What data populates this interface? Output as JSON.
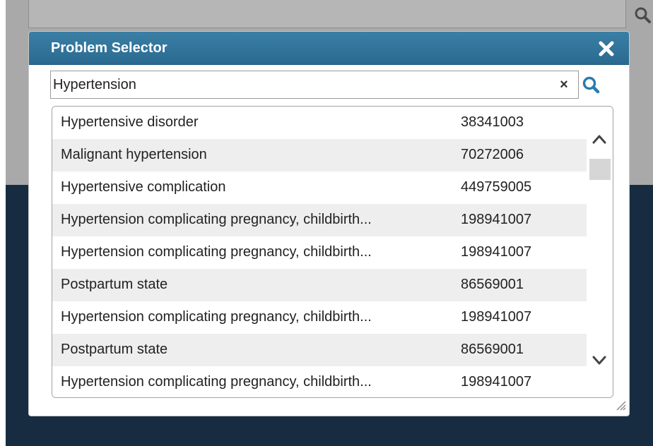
{
  "dialog": {
    "title": "Problem Selector",
    "close_icon": "close-icon"
  },
  "search": {
    "value": "Hypertension",
    "placeholder": "",
    "clear_label": "×",
    "search_icon": "search-icon"
  },
  "results": [
    {
      "name": "Hypertensive disorder",
      "code": "38341003"
    },
    {
      "name": "Malignant hypertension",
      "code": "70272006"
    },
    {
      "name": "Hypertensive complication",
      "code": "449759005"
    },
    {
      "name": "Hypertension complicating pregnancy, childbirth...",
      "code": "198941007"
    },
    {
      "name": "Hypertension complicating pregnancy, childbirth...",
      "code": "198941007"
    },
    {
      "name": "Postpartum state",
      "code": "86569001"
    },
    {
      "name": "Hypertension complicating pregnancy, childbirth...",
      "code": "198941007"
    },
    {
      "name": "Postpartum state",
      "code": "86569001"
    },
    {
      "name": "Hypertension complicating pregnancy, childbirth...",
      "code": "198941007"
    }
  ],
  "colors": {
    "titlebar": "#2f7199",
    "background_navy": "#172c40",
    "background_gray": "#a9a9a9",
    "search_icon": "#2a7bb0"
  }
}
